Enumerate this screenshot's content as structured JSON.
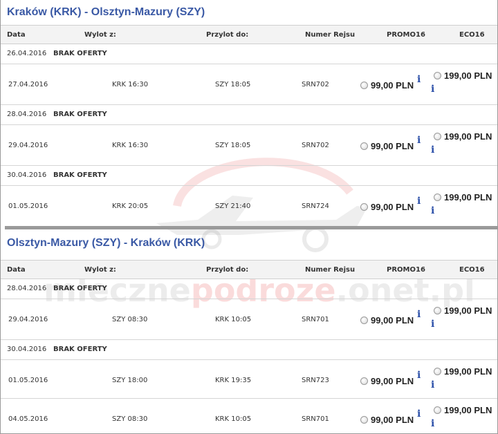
{
  "columns": {
    "date": "Data",
    "departure": "Wylot z:",
    "arrival": "Przylot do:",
    "flight": "Numer Rejsu",
    "promo": "PROMO16",
    "eco": "ECO16"
  },
  "sections": [
    {
      "title": "Kraków (KRK) - Olsztyn-Mazury (SZY)",
      "rows": [
        {
          "type": "none",
          "date": "26.04.2016",
          "label": "BRAK OFERTY"
        },
        {
          "type": "flight",
          "date": "27.04.2016",
          "dep": "KRK 16:30",
          "arr": "SZY 18:05",
          "flight": "SRN702",
          "promo": "99,00 PLN",
          "eco": "199,00 PLN"
        },
        {
          "type": "none",
          "date": "28.04.2016",
          "label": "BRAK OFERTY"
        },
        {
          "type": "flight",
          "date": "29.04.2016",
          "dep": "KRK 16:30",
          "arr": "SZY 18:05",
          "flight": "SRN702",
          "promo": "99,00 PLN",
          "eco": "199,00 PLN"
        },
        {
          "type": "none",
          "date": "30.04.2016",
          "label": "BRAK OFERTY"
        },
        {
          "type": "flight",
          "date": "01.05.2016",
          "dep": "KRK 20:05",
          "arr": "SZY 21:40",
          "flight": "SRN724",
          "promo": "99,00 PLN",
          "eco": "199,00 PLN"
        }
      ]
    },
    {
      "title": "Olsztyn-Mazury (SZY) - Kraków (KRK)",
      "rows": [
        {
          "type": "none",
          "date": "28.04.2016",
          "label": "BRAK OFERTY"
        },
        {
          "type": "flight",
          "date": "29.04.2016",
          "dep": "SZY 08:30",
          "arr": "KRK 10:05",
          "flight": "SRN701",
          "promo": "99,00 PLN",
          "eco": "199,00 PLN"
        },
        {
          "type": "none",
          "date": "30.04.2016",
          "label": "BRAK OFERTY"
        },
        {
          "type": "flight",
          "date": "01.05.2016",
          "dep": "SZY 18:00",
          "arr": "KRK 19:35",
          "flight": "SRN723",
          "promo": "99,00 PLN",
          "eco": "199,00 PLN"
        },
        {
          "type": "flight",
          "date": "04.05.2016",
          "dep": "SZY 08:30",
          "arr": "KRK 10:05",
          "flight": "SRN701",
          "promo": "99,00 PLN",
          "eco": "199,00 PLN"
        }
      ]
    }
  ],
  "info_glyph": "i",
  "watermark": {
    "part1": "mleczne",
    "part2": "podroze",
    "part3": ".onet.pl"
  },
  "colors": {
    "title": "#3a59a5",
    "info": "#2b4fa8",
    "header_bg": "#f3f3f3",
    "watermark_red": "#e65a5a"
  }
}
